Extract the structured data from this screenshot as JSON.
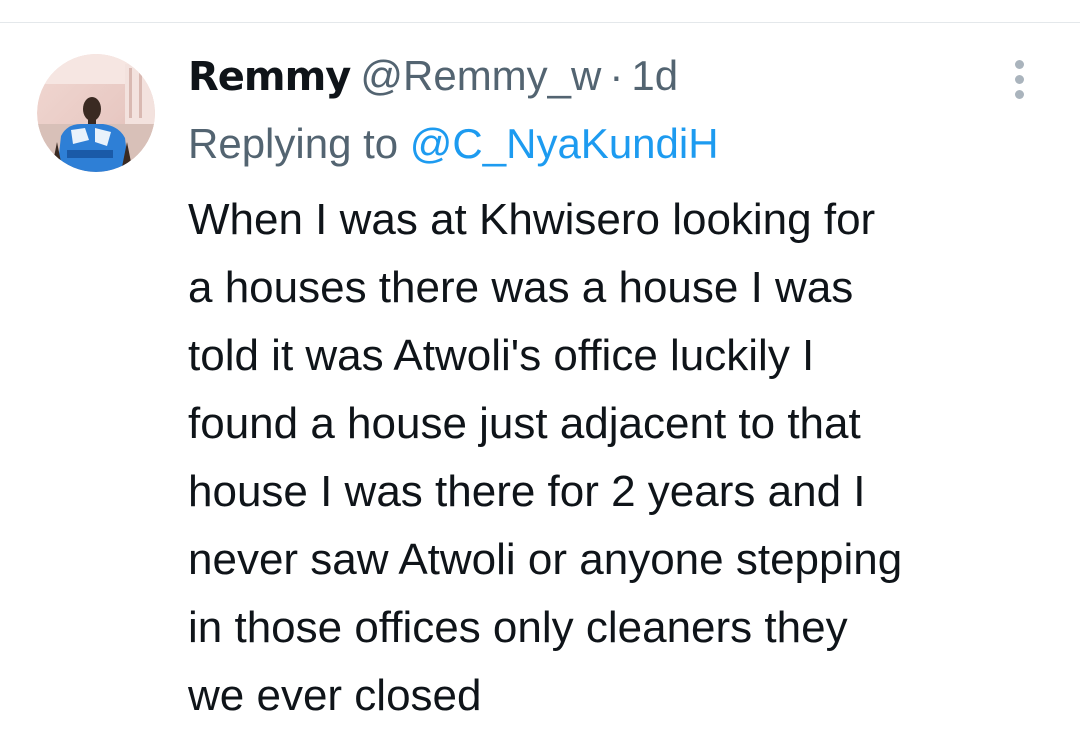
{
  "tweet": {
    "author": {
      "display_name": "Remmy",
      "handle": "@Remmy_w",
      "avatar_icon": "user-photo-avatar"
    },
    "separator": "·",
    "timestamp": "1d",
    "reply": {
      "prefix": "Replying to",
      "to_handle": "@C_NyaKundiH"
    },
    "text_lines": [
      "When I was at Khwisero looking for",
      "a houses there was a house I was",
      "told it was Atwoli's office luckily I",
      "found a house just adjacent to that",
      "house I was there for 2 years and I",
      "never saw Atwoli or anyone stepping",
      "in those offices only cleaners they",
      "we ever closed"
    ],
    "more_icon": "more-vertical-icon"
  },
  "colors": {
    "primary_text": "#0f1419",
    "secondary_text": "#536471",
    "link": "#1d9bf0",
    "divider": "#e4e8eb"
  }
}
